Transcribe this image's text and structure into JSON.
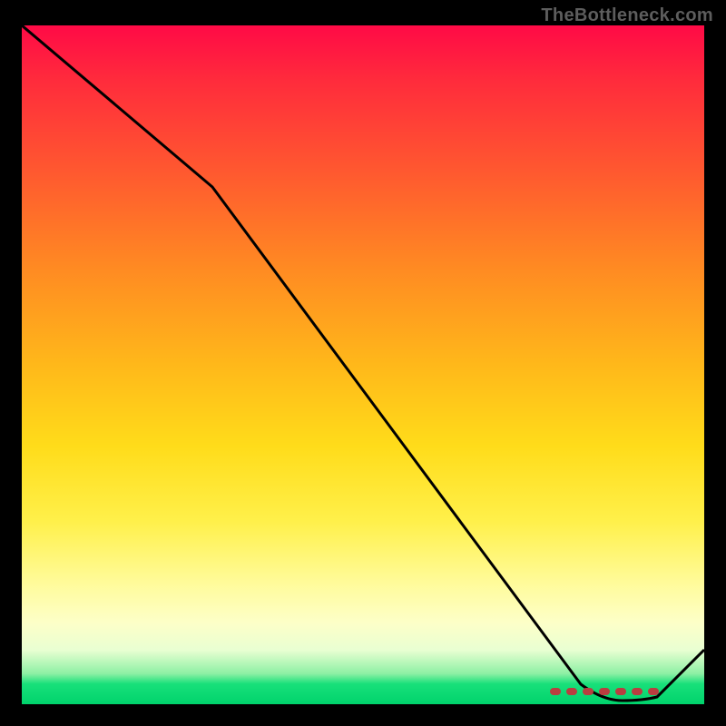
{
  "watermark": "TheBottleneck.com",
  "chart_data": {
    "type": "line",
    "title": "",
    "xlabel": "",
    "ylabel": "",
    "xlim": [
      0,
      100
    ],
    "ylim": [
      0,
      100
    ],
    "grid": false,
    "series": [
      {
        "name": "bottleneck-curve",
        "x": [
          0,
          28,
          82,
          88,
          92,
          100
        ],
        "values": [
          100,
          76,
          3,
          0.5,
          0.5,
          8
        ]
      }
    ],
    "marker_band": {
      "name": "optimal-zone-dots",
      "x_start": 78,
      "x_end": 93,
      "y": 2
    },
    "background_gradient": {
      "top": "#ff0a46",
      "mid_upper": "#ff8b22",
      "mid": "#ffdc1a",
      "mid_lower": "#fffb99",
      "bottom": "#00d36c"
    }
  }
}
